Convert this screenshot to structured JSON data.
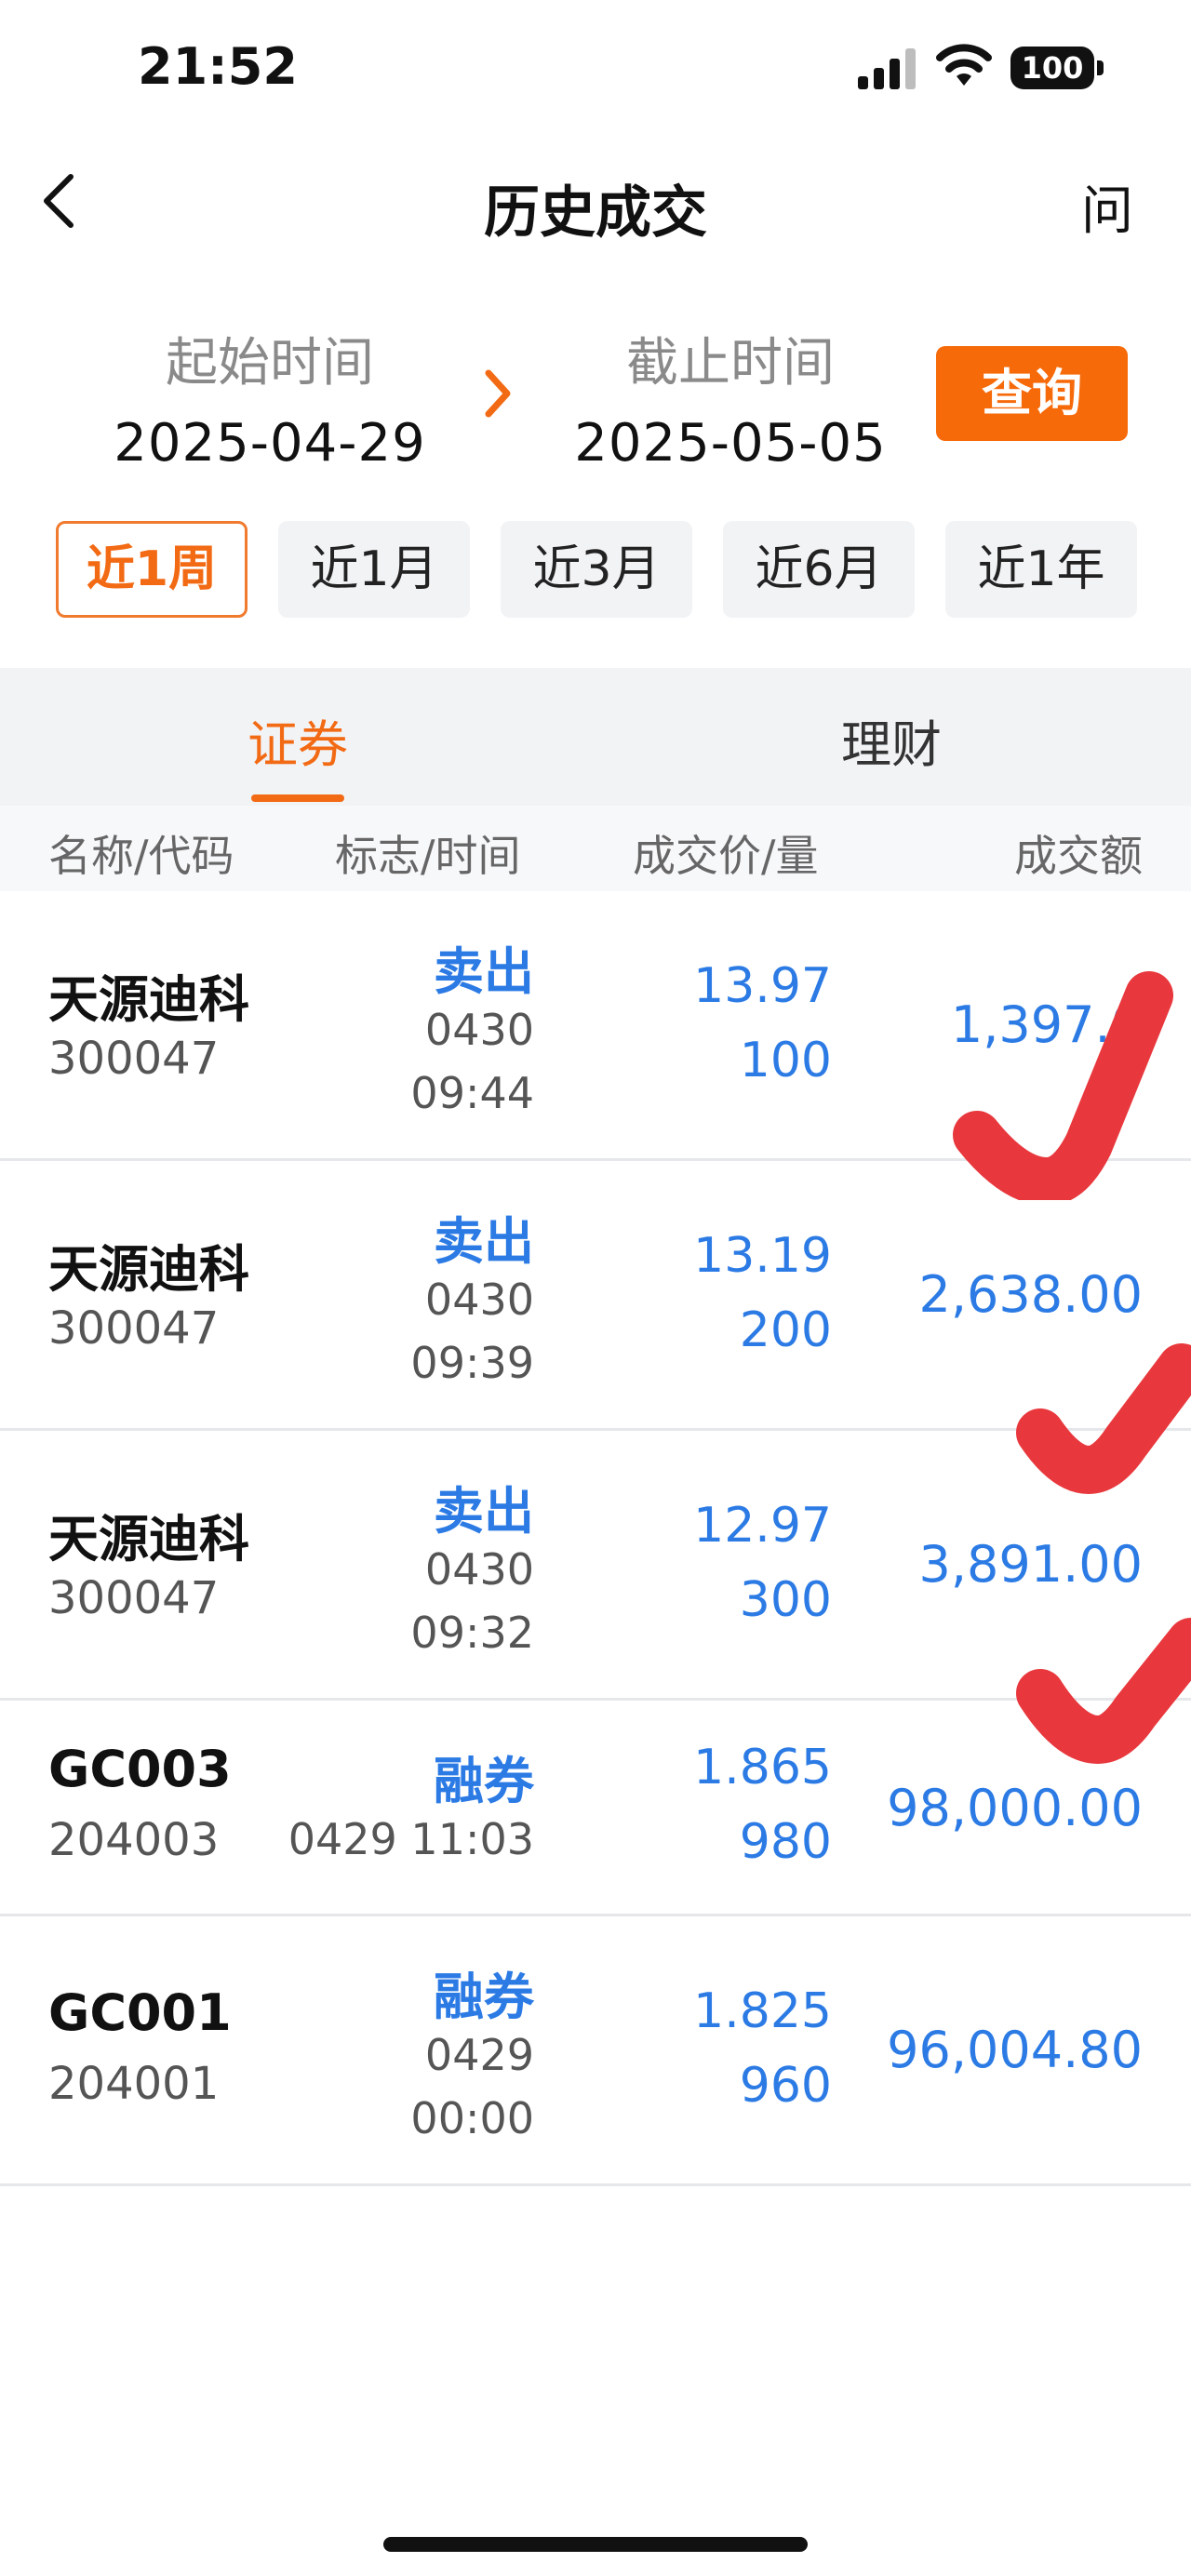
{
  "status_bar": {
    "time": "21:52",
    "battery": "100"
  },
  "nav": {
    "title": "历史成交",
    "help": "问"
  },
  "date_range": {
    "start_label": "起始时间",
    "start_value": "2025-04-29",
    "end_label": "截止时间",
    "end_value": "2025-05-05",
    "query_label": "查询"
  },
  "periods": [
    "近1周",
    "近1月",
    "近3月",
    "近6月",
    "近1年"
  ],
  "active_period": "近1周",
  "tabs": {
    "securities": "证券",
    "wealth": "理财"
  },
  "table": {
    "headers": {
      "name": "名称/代码",
      "flag": "标志/时间",
      "price": "成交价/量",
      "amount": "成交额"
    },
    "rows": [
      {
        "name": "天源迪科",
        "code": "300047",
        "flag": "卖出",
        "date": "0430",
        "time": "09:44",
        "price": "13.97",
        "qty": "100",
        "amount": "1,397.0"
      },
      {
        "name": "天源迪科",
        "code": "300047",
        "flag": "卖出",
        "date": "0430",
        "time": "09:39",
        "price": "13.19",
        "qty": "200",
        "amount": "2,638.00"
      },
      {
        "name": "天源迪科",
        "code": "300047",
        "flag": "卖出",
        "date": "0430",
        "time": "09:32",
        "price": "12.97",
        "qty": "300",
        "amount": "3,891.00"
      },
      {
        "name": "GC003",
        "code": "204003",
        "flag": "融券",
        "datetime": "0429 11:03",
        "price": "1.865",
        "qty": "980",
        "amount": "98,000.00"
      },
      {
        "name": "GC001",
        "code": "204001",
        "flag": "融券",
        "date": "0429",
        "time": "00:00",
        "price": "1.825",
        "qty": "960",
        "amount": "96,004.80"
      }
    ]
  },
  "colors": {
    "accent": "#f26a14",
    "link_blue": "#2c7be5",
    "check_red": "#e8383d"
  }
}
